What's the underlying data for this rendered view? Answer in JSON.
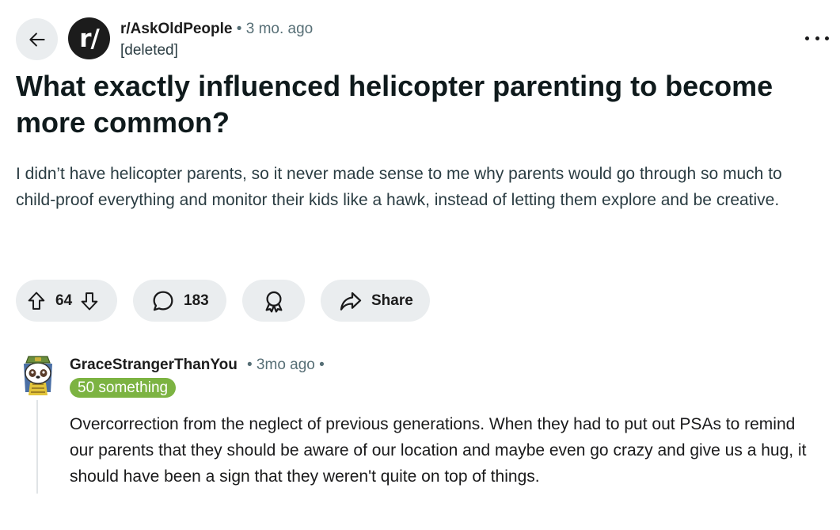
{
  "post": {
    "subreddit": "r/AskOldPeople",
    "subreddit_icon_text": "r/",
    "separator": "•",
    "time": "3 mo. ago",
    "author": "[deleted]",
    "title": "What exactly influenced helicopter parenting to become more common?",
    "body": "I didn’t have helicopter parents, so it never made sense to me why parents would go through so much to child-proof everything and monitor their kids like a hawk, instead of letting them explore and be creative."
  },
  "actions": {
    "upvotes": "64",
    "comments": "183",
    "share_label": "Share"
  },
  "icons": {
    "back": "arrow-left-icon",
    "more": "more-options-icon",
    "upvote": "upvote-arrow-icon",
    "downvote": "downvote-arrow-icon",
    "comment": "comment-bubble-icon",
    "award": "award-ribbon-icon",
    "share": "share-arrow-icon"
  },
  "comment": {
    "author": "GraceStrangerThanYou",
    "meta": "• 3mo ago •",
    "flair": "50 something",
    "body": "Overcorrection from the neglect of previous generations. When they had to put out PSAs to remind our parents that they should be aware of our location and maybe even go crazy and give us a hug, it should have been a sign that they weren't quite on top of things."
  },
  "colors": {
    "pill_bg": "#eaedef",
    "flair_bg": "#7cb342",
    "meta_gray": "#576f76",
    "text_dark": "#1a1a1b"
  }
}
